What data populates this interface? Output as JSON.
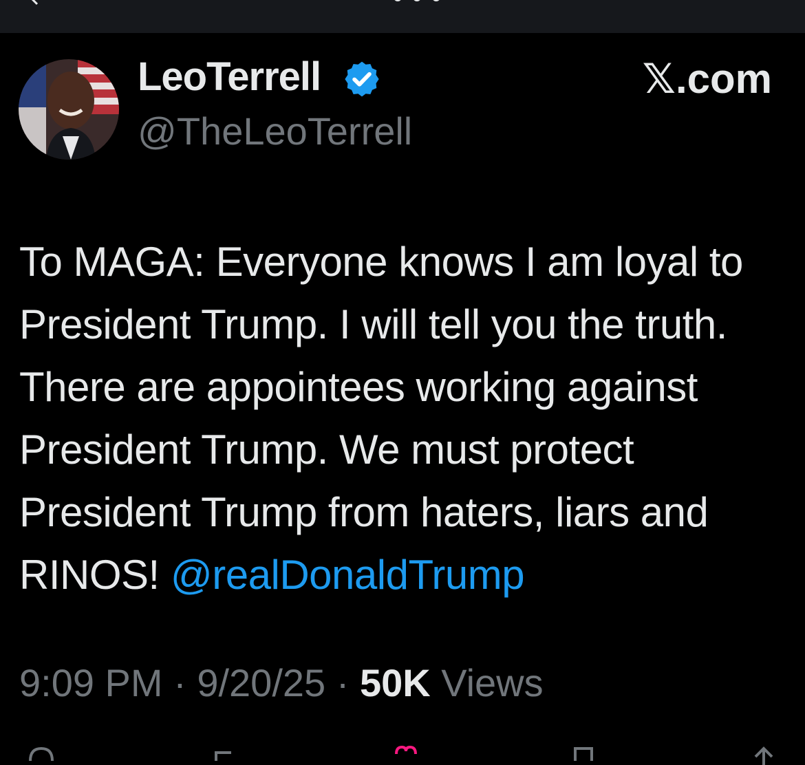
{
  "header": {
    "back_icon": "back-arrow-icon",
    "more_icon": "more-dots-icon"
  },
  "post": {
    "author_name": "LeoTerrell",
    "author_handle": "@TheLeoTerrell",
    "verified_icon": "verified-badge-icon",
    "brand": "𝕏.com",
    "text_before_mention": "To MAGA: Everyone knows I am loyal to President Trump. I will tell you the truth. There are appointees working against President Trump. We must protect President Trump from haters, liars and RINOS! ",
    "mention": "@realDonaldTrump",
    "time": "9:09 PM",
    "separator": " · ",
    "date": "9/20/25",
    "views_count": "50K",
    "views_label": " Views"
  },
  "colors": {
    "background": "#000000",
    "text": "#e7e9ea",
    "secondary_text": "#71767b",
    "accent": "#1d9bf0"
  },
  "actions": [
    {
      "name": "reply-icon"
    },
    {
      "name": "repost-icon"
    },
    {
      "name": "like-icon"
    },
    {
      "name": "bookmark-icon"
    },
    {
      "name": "share-icon"
    }
  ]
}
